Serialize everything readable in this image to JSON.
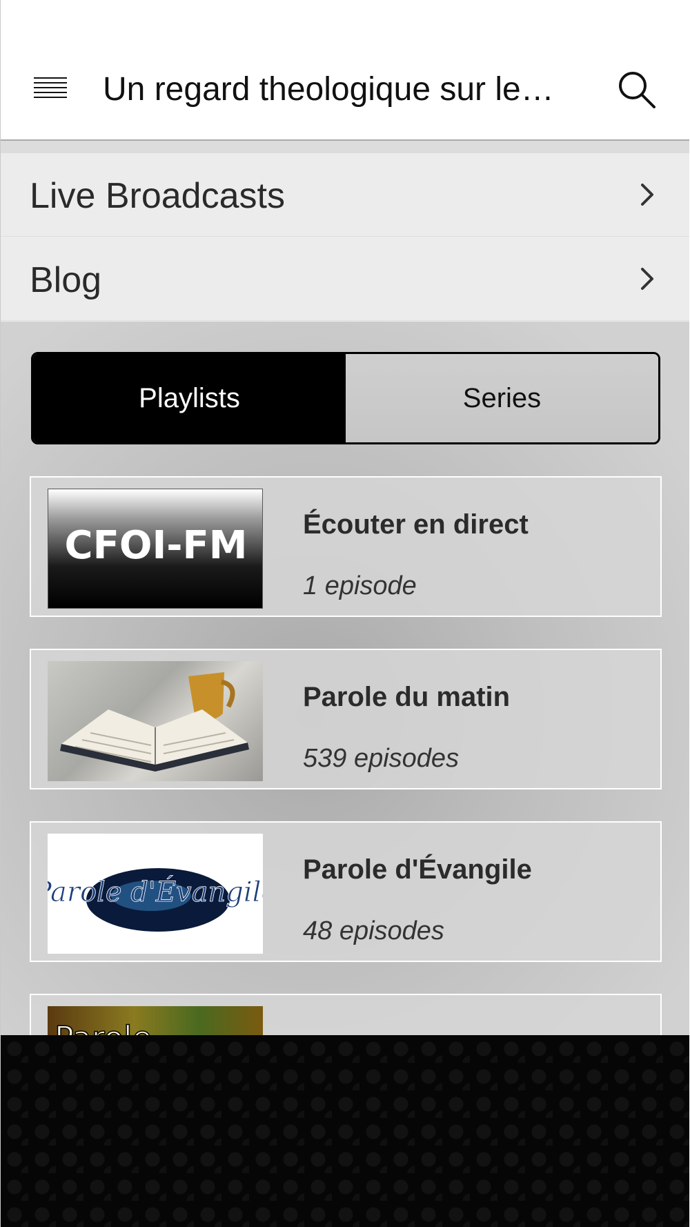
{
  "header": {
    "title": "Un regard theologique sur le…",
    "menu_icon": "hamburger-menu-icon",
    "search_icon": "search-icon"
  },
  "menu": {
    "items": [
      {
        "label": "Live Broadcasts",
        "icon": "chevron-right-icon"
      },
      {
        "label": "Blog",
        "icon": "chevron-right-icon"
      }
    ]
  },
  "segmented": {
    "options": [
      "Playlists",
      "Series"
    ],
    "selected": "Playlists"
  },
  "playlists": [
    {
      "title": "Écouter en direct",
      "subtitle": "1 episode",
      "thumbnail_text": "CFOI-FM"
    },
    {
      "title": "Parole du matin",
      "subtitle": "539 episodes",
      "thumbnail_text": ""
    },
    {
      "title": "Parole d'Évangile",
      "subtitle": "48 episodes",
      "thumbnail_text": "Parole d'Évangile"
    },
    {
      "title": "",
      "subtitle": "",
      "thumbnail_text": "Parole"
    }
  ],
  "colors": {
    "header_bg": "#ffffff",
    "menu_bg": "#ececec",
    "segment_active_bg": "#000000",
    "segment_inactive_bg": "#c9c9c9",
    "bottom_panel_bg": "#060606"
  }
}
